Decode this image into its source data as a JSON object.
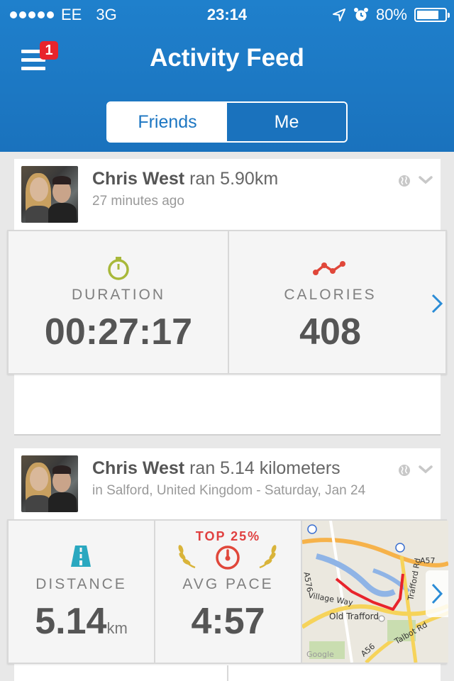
{
  "status_bar": {
    "carrier": "EE",
    "network": "3G",
    "time": "23:14",
    "battery": "80%",
    "battery_level": 0.8
  },
  "header": {
    "title": "Activity Feed",
    "notification_count": "1",
    "tabs": [
      {
        "label": "Friends",
        "active": true
      },
      {
        "label": "Me",
        "active": false
      }
    ]
  },
  "feed": [
    {
      "name": "Chris West",
      "action": " ran 5.90km",
      "subtitle": "27 minutes ago",
      "stats": [
        {
          "icon": "stopwatch-icon",
          "label": "DURATION",
          "value": "00:27:17"
        },
        {
          "icon": "calories-trend-icon",
          "label": "CALORIES",
          "value": "408"
        }
      ]
    },
    {
      "name": "Chris West",
      "action": " ran 5.14 kilometers",
      "subtitle": "in Salford, United Kingdom - Saturday, Jan 24",
      "badge": "TOP 25%",
      "stats": [
        {
          "icon": "road-icon",
          "label": "DISTANCE",
          "value": "5.14",
          "unit": "km"
        },
        {
          "icon": "speedometer-icon",
          "label": "AVG PACE",
          "value": "4:57"
        }
      ],
      "map_labels": [
        "Village Way",
        "Old Trafford",
        "Talbot Rd",
        "Trafford Rd",
        "A576",
        "A56",
        "A57",
        "Google"
      ]
    }
  ],
  "colors": {
    "brand_blue": "#1c76c2",
    "badge_red": "#e8242c",
    "calories_red": "#e0473a",
    "stopwatch_green": "#a8b83a",
    "road_teal": "#2aa8c0",
    "laurel_gold": "#d9b43a"
  }
}
